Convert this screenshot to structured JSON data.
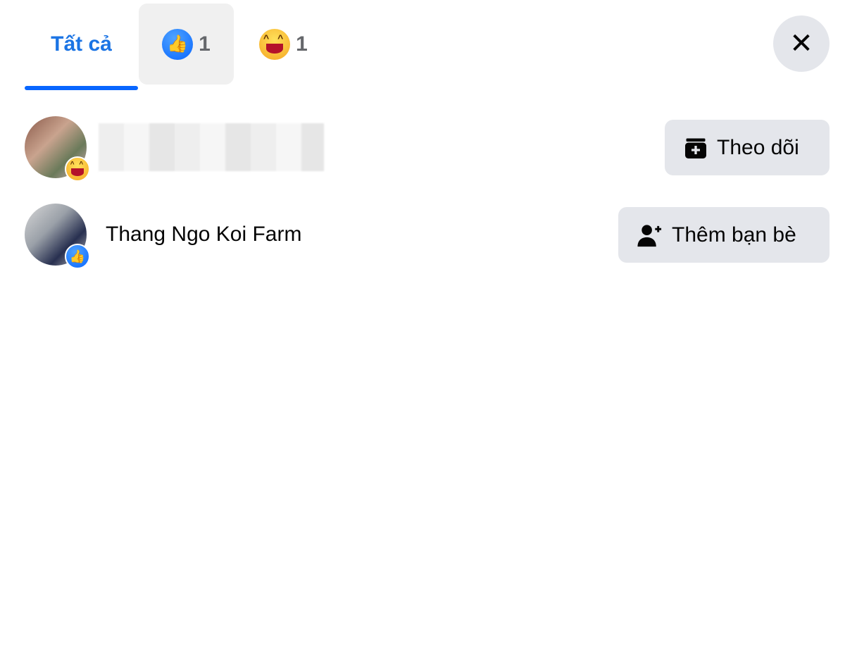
{
  "tabs": [
    {
      "label": "Tất cả",
      "active": true
    },
    {
      "icon": "like-reaction-icon",
      "count": "1"
    },
    {
      "icon": "haha-reaction-icon",
      "count": "1"
    }
  ],
  "close_icon": "close-icon",
  "accent_color": "#0866ff",
  "people": [
    {
      "name": "",
      "reaction": "haha",
      "action": {
        "label": "Theo dõi",
        "icon": "follow-icon"
      }
    },
    {
      "name": "Thang Ngo Koi Farm",
      "reaction": "like",
      "action": {
        "label": "Thêm bạn bè",
        "icon": "add-friend-icon"
      }
    }
  ]
}
